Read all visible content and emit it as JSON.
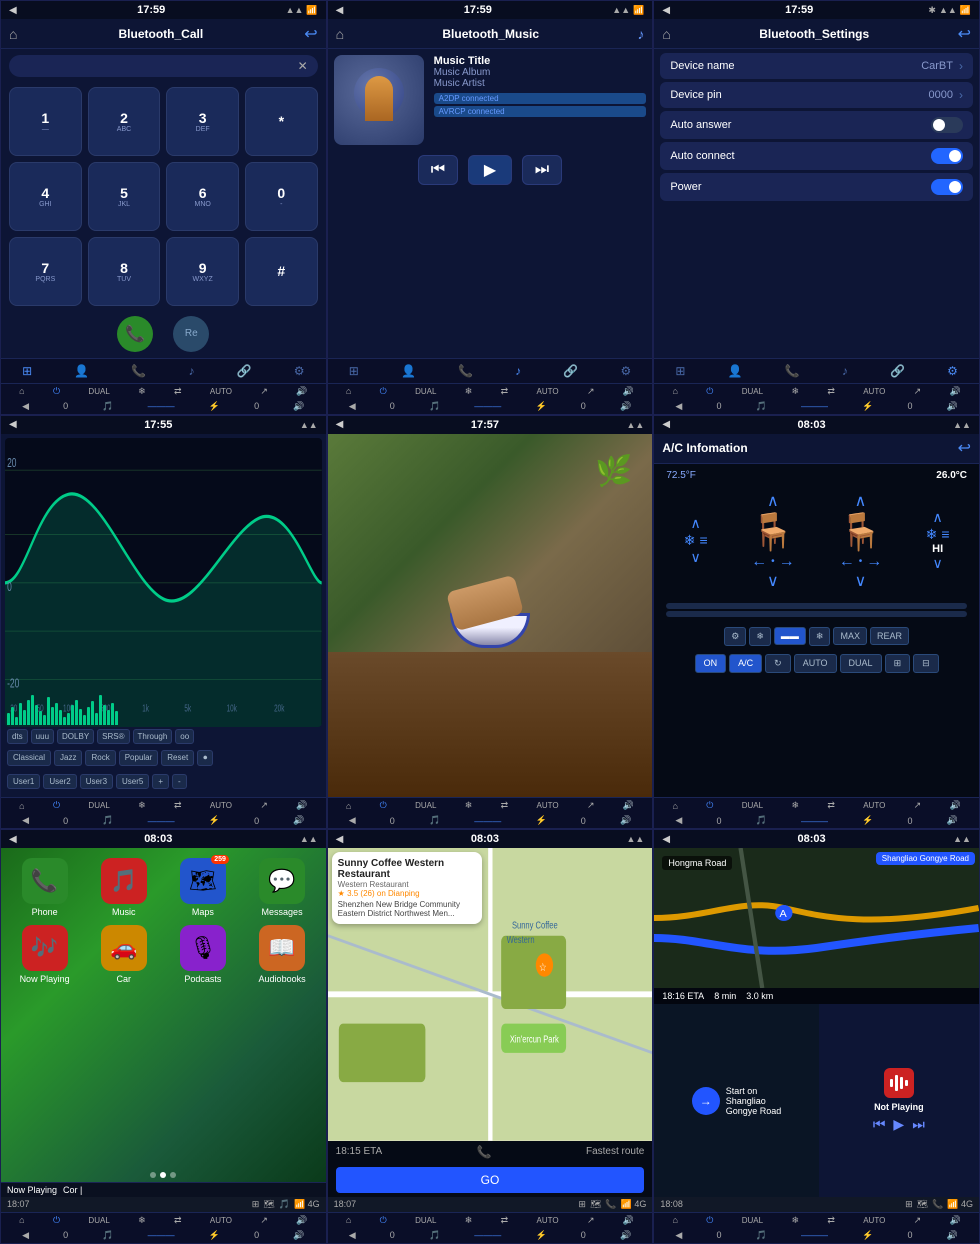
{
  "panel1": {
    "statusBar": {
      "time": "17:59",
      "back": "◀"
    },
    "title": "Bluetooth_Call",
    "searchPlaceholder": "",
    "dialpad": [
      {
        "num": "1",
        "sub": "—"
      },
      {
        "num": "2",
        "sub": "ABC"
      },
      {
        "num": "3",
        "sub": "DEF"
      },
      {
        "num": "*",
        "sub": ""
      },
      {
        "num": "4",
        "sub": "GHI"
      },
      {
        "num": "5",
        "sub": "JKL"
      },
      {
        "num": "6",
        "sub": "MNO"
      },
      {
        "num": "0",
        "sub": "-"
      },
      {
        "num": "7",
        "sub": "PQRS"
      },
      {
        "num": "8",
        "sub": "TUV"
      },
      {
        "num": "9",
        "sub": "WXYZ"
      },
      {
        "num": "#",
        "sub": ""
      }
    ],
    "callBtn": "📞",
    "hangupBtn": "Re"
  },
  "panel2": {
    "statusBar": {
      "time": "17:59"
    },
    "title": "Bluetooth_Music",
    "musicTitle": "Music Title",
    "musicAlbum": "Music Album",
    "musicArtist": "Music Artist",
    "badge1": "A2DP connected",
    "badge2": "AVRCP connected",
    "prevBtn": "⏮",
    "playBtn": "▶",
    "nextBtn": "⏭"
  },
  "panel3": {
    "statusBar": {
      "time": "17:59"
    },
    "title": "Bluetooth_Settings",
    "settings": [
      {
        "label": "Device name",
        "value": "CarBT",
        "type": "chevron"
      },
      {
        "label": "Device pin",
        "value": "0000",
        "type": "chevron"
      },
      {
        "label": "Auto answer",
        "value": "",
        "type": "toggle",
        "state": "off"
      },
      {
        "label": "Auto connect",
        "value": "",
        "type": "toggle",
        "state": "on"
      },
      {
        "label": "Power",
        "value": "",
        "type": "toggle",
        "state": "on"
      }
    ]
  },
  "panel4": {
    "statusBar": {
      "time": "17:55"
    },
    "formatBtns": [
      "dts",
      "uuu",
      "DOLBY",
      "SRS®",
      "Through",
      "oo"
    ],
    "presets": [
      "Classical",
      "Jazz",
      "Rock",
      "Popular",
      "Reset",
      ""
    ],
    "users": [
      "User1",
      "User2",
      "User3",
      "User5",
      "+",
      "-"
    ]
  },
  "panel5": {
    "statusBar": {
      "time": "17:57"
    },
    "videoLabel": ""
  },
  "panel6": {
    "statusBar": {
      "time": "08:03"
    },
    "title": "A/C Infomation",
    "temp": "26.0°C",
    "leftTemp": "72.5°F",
    "rightLabel": "HI",
    "modeButtons": [
      "ON",
      "A/C",
      "↻",
      "AUTO",
      "DUAL",
      "⊞",
      "⊟"
    ],
    "ctrlButtons": [
      "⚙",
      "❄",
      "▬▬",
      "❄",
      "MAX",
      "REAR"
    ]
  },
  "panel7": {
    "statusBar": {
      "time": "08:03"
    },
    "apps": [
      {
        "label": "Phone",
        "color": "#2a8a2a",
        "icon": "📞",
        "badge": null
      },
      {
        "label": "Music",
        "color": "#cc2222",
        "icon": "🎵",
        "badge": null
      },
      {
        "label": "Maps",
        "color": "#2255cc",
        "icon": "🗺",
        "badge": null
      },
      {
        "label": "Messages",
        "color": "#2a8a2a",
        "icon": "💬",
        "badge": "259"
      },
      {
        "label": "Now Playing",
        "color": "#cc2222",
        "icon": "🎶",
        "badge": null
      },
      {
        "label": "Car",
        "color": "#cc8800",
        "icon": "🚗",
        "badge": null
      },
      {
        "label": "Podcasts",
        "color": "#8822cc",
        "icon": "🎙",
        "badge": null
      },
      {
        "label": "Audiobooks",
        "color": "#cc6622",
        "icon": "📖",
        "badge": null
      }
    ],
    "statusTime": "18:07",
    "nowPlaying": "Now Playing",
    "nowPlayingBar": "Cor |"
  },
  "panel8": {
    "statusBar": {
      "time": "08:03"
    },
    "venueName": "Sunny Coffee Western Restaurant",
    "venueType": "Western Restaurant",
    "rating": "3.5",
    "reviewCount": "26",
    "reviewSource": "Dianping",
    "address": "Shenzhen New Bridge Community Eastern District Northwest Men...",
    "etaTime": "18:15 ETA",
    "etaLabel": "Fastest route",
    "goBtn": "GO",
    "statusTime": "18:07"
  },
  "panel9": {
    "statusBar": {
      "time": "08:03"
    },
    "road": "Hongma Road",
    "routeName": "Shangliao Gongye Road",
    "eta": "18:16 ETA",
    "etaDuration": "8 min",
    "etaDistance": "3.0 km",
    "startLabel": "Start on\nShangliao\nGongye Road",
    "notPlaying": "Not Playing",
    "statusTime": "18:08"
  },
  "navBar": {
    "icons": [
      "⊞",
      "⌂",
      "❄",
      "✿",
      "⇄",
      "AUTO",
      "↗",
      "🔊"
    ],
    "climateLeft": [
      "◀",
      "0",
      "🎵",
      "—————",
      "⚡",
      "0",
      "🔊"
    ]
  }
}
